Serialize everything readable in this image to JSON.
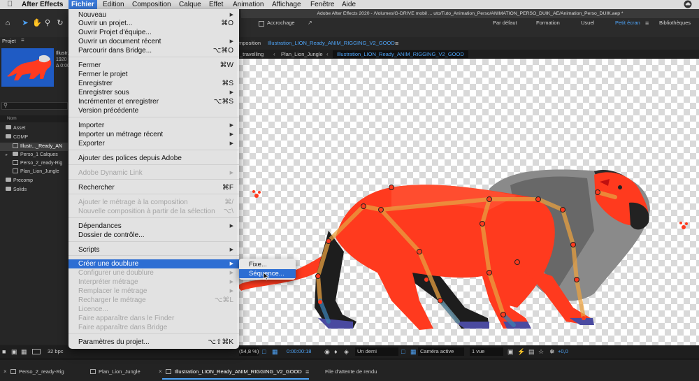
{
  "menubar": {
    "apple": "",
    "app": "After Effects",
    "items": [
      "Fichier",
      "Edition",
      "Composition",
      "Calque",
      "Effet",
      "Animation",
      "Affichage",
      "Fenêtre",
      "Aide"
    ]
  },
  "window_title": "Adobe After Effects 2020 - /Volumes/G-DRIVE mobil ... uto/Tuto_Animation_Perso/ANIMATION_PERSO_DUIK_AE/Animation_Perso_DUIK.aep *",
  "toolbar": {
    "snapping_label": "Accrochage",
    "workspaces": [
      "Par défaut",
      "Formation",
      "Usuel",
      "Petit écran",
      "Bibliothèques"
    ],
    "active_workspace": "Petit écran"
  },
  "project_panel": {
    "title": "Projet",
    "thumb_name": "Illustr...",
    "thumb_info1": "1920 ...",
    "thumb_info2": "Δ 0:00...",
    "column_header": "Nom",
    "rows": [
      {
        "label": "Asset",
        "type": "folder",
        "indent": 0
      },
      {
        "label": "COMP",
        "type": "folder",
        "indent": 0
      },
      {
        "label": "Illustr..._Ready_AN",
        "type": "comp",
        "indent": 1
      },
      {
        "label": "Perso_1 Calques",
        "type": "folder",
        "indent": 1
      },
      {
        "label": "Perso_2_ready-Rig",
        "type": "comp",
        "indent": 1
      },
      {
        "label": "Plan_Lion_Jungle",
        "type": "comp",
        "indent": 1
      },
      {
        "label": "Precomp",
        "type": "folder",
        "indent": 0
      },
      {
        "label": "Solids",
        "type": "folder",
        "indent": 0
      }
    ]
  },
  "comp_panel": {
    "header_prefix": "mposition",
    "comp_name": "Illustration_LION_Ready_ANIM_RIGGING_V2_GOOD",
    "nav": [
      "_travelling",
      "Plan_Lion_Jungle",
      "Illustration_LION_Ready_ANIM_RIGGING_V2_GOOD"
    ]
  },
  "viewer_bar": {
    "bit_depth": "32 bpc",
    "zoom": "(54,8 %)",
    "timecode": "0:00:00:18",
    "resolution": "Un demi",
    "camera": "Caméra active",
    "views": "1 vue",
    "exposure": "+0,0"
  },
  "timeline_tabs": [
    "Perso_2_ready-Rig",
    "Plan_Lion_Jungle",
    "Illustration_LION_Ready_ANIM_RIGGING_V2_GOOD",
    "File d'attente de rendu"
  ],
  "active_timeline_tab": "Illustration_LION_Ready_ANIM_RIGGING_V2_GOOD",
  "file_menu": {
    "title": "Fichier",
    "items": [
      {
        "label": "Nouveau",
        "shortcut": "",
        "submenu": true,
        "disabled": false
      },
      {
        "label": "Ouvrir un projet...",
        "shortcut": "⌘O",
        "submenu": false,
        "disabled": false
      },
      {
        "label": "Ouvrir Projet d'équipe...",
        "shortcut": "",
        "submenu": false,
        "disabled": false
      },
      {
        "label": "Ouvrir un document récent",
        "shortcut": "",
        "submenu": true,
        "disabled": false
      },
      {
        "label": "Parcourir dans Bridge...",
        "shortcut": "⌥⌘O",
        "submenu": false,
        "disabled": false
      },
      {
        "label": "Fermer",
        "shortcut": "⌘W",
        "submenu": false,
        "disabled": false
      },
      {
        "label": "Fermer le projet",
        "shortcut": "",
        "submenu": false,
        "disabled": false
      },
      {
        "label": "Enregistrer",
        "shortcut": "⌘S",
        "submenu": false,
        "disabled": false
      },
      {
        "label": "Enregistrer sous",
        "shortcut": "",
        "submenu": true,
        "disabled": false
      },
      {
        "label": "Incrémenter et enregistrer",
        "shortcut": "⌥⌘S",
        "submenu": false,
        "disabled": false
      },
      {
        "label": "Version précédente",
        "shortcut": "",
        "submenu": false,
        "disabled": false
      },
      {
        "label": "Importer",
        "shortcut": "",
        "submenu": true,
        "disabled": false
      },
      {
        "label": "Importer un métrage récent",
        "shortcut": "",
        "submenu": true,
        "disabled": false
      },
      {
        "label": "Exporter",
        "shortcut": "",
        "submenu": true,
        "disabled": false
      },
      {
        "label": "Ajouter des polices depuis Adobe",
        "shortcut": "",
        "submenu": false,
        "disabled": false
      },
      {
        "label": "Adobe Dynamic Link",
        "shortcut": "",
        "submenu": true,
        "disabled": true
      },
      {
        "label": "Rechercher",
        "shortcut": "⌘F",
        "submenu": false,
        "disabled": false
      },
      {
        "label": "Ajouter le métrage à la composition",
        "shortcut": "⌘/",
        "submenu": false,
        "disabled": true
      },
      {
        "label": "Nouvelle composition à partir de la sélection",
        "shortcut": "⌥\\",
        "submenu": false,
        "disabled": true
      },
      {
        "label": "Dépendances",
        "shortcut": "",
        "submenu": true,
        "disabled": false
      },
      {
        "label": "Dossier de contrôle...",
        "shortcut": "",
        "submenu": false,
        "disabled": false
      },
      {
        "label": "Scripts",
        "shortcut": "",
        "submenu": true,
        "disabled": false
      },
      {
        "label": "Créer une doublure",
        "shortcut": "",
        "submenu": true,
        "disabled": false,
        "highlighted": true
      },
      {
        "label": "Configurer une doublure",
        "shortcut": "",
        "submenu": true,
        "disabled": true
      },
      {
        "label": "Interpréter métrage",
        "shortcut": "",
        "submenu": true,
        "disabled": true
      },
      {
        "label": "Remplacer le métrage",
        "shortcut": "",
        "submenu": true,
        "disabled": true
      },
      {
        "label": "Recharger le métrage",
        "shortcut": "⌥⌘L",
        "submenu": false,
        "disabled": true
      },
      {
        "label": "Licence...",
        "shortcut": "",
        "submenu": false,
        "disabled": true
      },
      {
        "label": "Faire apparaître dans le Finder",
        "shortcut": "",
        "submenu": false,
        "disabled": true
      },
      {
        "label": "Faire apparaître dans Bridge",
        "shortcut": "",
        "submenu": false,
        "disabled": true
      },
      {
        "label": "Paramètres du projet...",
        "shortcut": "⌥⇧⌘K",
        "submenu": false,
        "disabled": false
      }
    ]
  },
  "proxy_submenu": {
    "items": [
      "Fixe...",
      "Séquence..."
    ],
    "highlighted": "Séquence..."
  }
}
